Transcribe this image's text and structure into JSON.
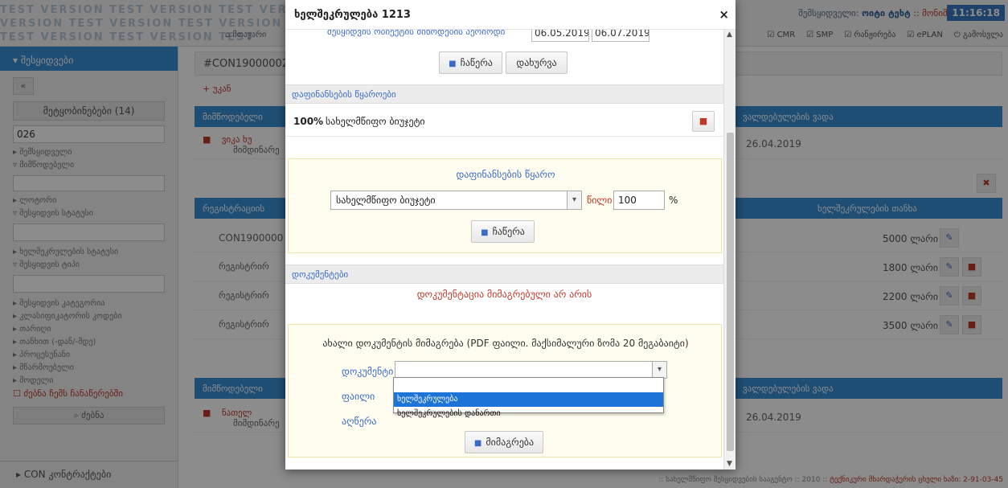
{
  "app": {
    "watermark_lines": [
      "TEST VERSION TEST VERSION TEST VERSION TEST",
      "VERSION TEST VERSION TEST VERSION",
      "TEST VERSION TEST VERSION TEST"
    ],
    "user_label": "შემსყიდველი:",
    "user_name": "ოიტი ტეხტ",
    "exit_label": ":: მონიშნე",
    "clock": "11:16:18",
    "top_nav_left": "მთავარი",
    "top_nav": [
      "CMR",
      "SMP",
      "რანჟირება",
      "ePLAN",
      "გამოსვლა"
    ]
  },
  "sidebar": {
    "header": "შესყიდვები",
    "collapse": "«",
    "filters_button": "მეტყობინებები (14)",
    "code_input": "026",
    "items_a": [
      "შემსყიდველი",
      "მიმწოდებელი"
    ],
    "items_b": [
      "ლოტორი",
      "შესყიდვის სტატუსი"
    ],
    "items_c": [
      "ხელშეკრულების სტატუსი",
      "შესყიდვის ტიპი"
    ],
    "items_d": [
      "შესყიდვის კატეგორია",
      "კლასიფიკატორის კოდები",
      "თარიღი",
      "თანხით (-დან/-მდე)",
      "პროცესუნანი",
      "მწარმოებელი",
      "მოდელი"
    ],
    "my_records": "ძებნა ჩემს ჩანაწერებში",
    "search_btn": "ძებნა",
    "bottom": "CON კონტრაქტები"
  },
  "main": {
    "title": "#CON19000002",
    "add_link": "+ უკან",
    "supplier_head": "მიმწოდებელი",
    "obligations_head": "ვალდებულების ვადა",
    "row1_name": "ვიკა ხუ",
    "row1_sub": "მიმდინარე",
    "row1_date": "26.04.2019",
    "reg_head": "რეგისტრაციის",
    "amount_head": "ხელშეკრულების თანხა",
    "reg_rows": [
      "CON1900000",
      "რეგისტრირ",
      "რეგისტრირ",
      "რეგისტრირ"
    ],
    "amounts": [
      "5000 ლარი",
      "1800 ლარი",
      "2200 ლარი",
      "3500 ლარი"
    ],
    "supplier2_head": "მიმწოდებელი",
    "obligations2_head": "ვალდებულების ვადა",
    "row2_name": "ნათელ",
    "row2_sub": "მიმდინარე",
    "row2_date": "26.04.2019",
    "status_bar_pre": ":: სახელმწიფო შესყიდვების სააგენტო :: 2010 :: ",
    "status_bar_red": "ტექნიკური მხარდაჭერის ცხელი ხაზი: 2-91-03-45"
  },
  "modal": {
    "title": "ხელშეკრულება 1213",
    "close": "×",
    "period_label": "შესყიდვის ობიექტის მიწოდების პერიოდი",
    "date_from": "06.05.2019",
    "date_to": "06.07.2019",
    "save_btn": "ჩაწერა",
    "close_btn": "დახურვა",
    "funding_head": "დაფინანსების წყაროები",
    "funding_pct": "100%",
    "funding_name": "სახელმწიფო ბიუჯეტი",
    "source_title": "დაფინანსების წყარო",
    "source_select": "სახელმწიფო ბიუჯეტი",
    "share_label": "წილი",
    "share_value": "100",
    "pct_sign": "%",
    "source_save_btn": "ჩაწერა",
    "docs_head": "დოკუმენტები",
    "no_docs": "დოკუმენტაცია მიმაგრებული არ არის",
    "upload_title": "ახალი დოკუმენტის მიმაგრება (PDF ფაილი. მაქსიმალური ზომა 20 მეგაბაიტი)",
    "doc_label": "დოკუმენტი",
    "doc_select": "",
    "file_label": "ფაილი",
    "desc_label": "აღწერა",
    "dropdown_options": [
      "",
      "ხელშეკრულება",
      "ხელშეკრულების დანართი"
    ],
    "attach_btn": "მიმაგრება"
  },
  "colors": {
    "accent": "#3a8fd6",
    "link": "#3a6bc8",
    "danger": "#c0392b",
    "selected": "#1e74d6"
  }
}
